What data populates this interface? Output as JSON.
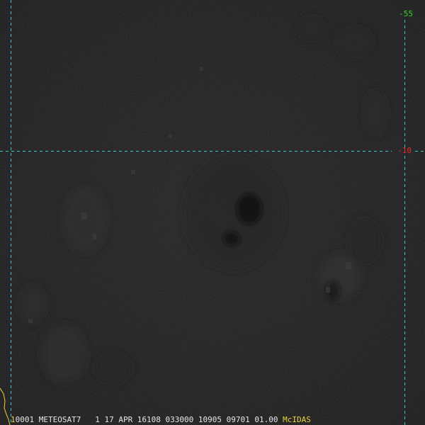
{
  "image": {
    "satellite": "METEOSAT7",
    "frame_number": "1",
    "bottom_caption": {
      "frame_index": "1",
      "text": "0001 METEOSAT7   1 17 APR 16108 033000 10905 09701 01.00",
      "software": "McIDAS"
    }
  },
  "grid": {
    "line_color": "#3fc6d6",
    "longitude_label": "-55",
    "longitude_label_color": "#2bd62b",
    "latitude_label": "-10",
    "latitude_label_color": "#e02a2a"
  },
  "coastline_color": "#e8d33a",
  "background_color": "#1b1b1b"
}
